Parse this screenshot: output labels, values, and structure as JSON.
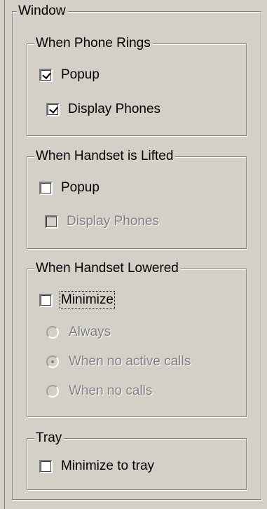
{
  "window_group": {
    "title": "Window",
    "phone_rings": {
      "title": "When Phone Rings",
      "popup": {
        "label": "Popup",
        "checked": true,
        "enabled": true
      },
      "display_phones": {
        "label": "Display Phones",
        "checked": true,
        "enabled": true
      }
    },
    "handset_lifted": {
      "title": "When Handset is Lifted",
      "popup": {
        "label": "Popup",
        "checked": false,
        "enabled": true
      },
      "display_phones": {
        "label": "Display Phones",
        "checked": false,
        "enabled": false
      }
    },
    "handset_lowered": {
      "title": "When Handset Lowered",
      "minimize": {
        "label": "Minimize",
        "checked": false,
        "enabled": true
      },
      "options": [
        {
          "label": "Always",
          "selected": false,
          "enabled": false
        },
        {
          "label": "When no active calls",
          "selected": true,
          "enabled": false
        },
        {
          "label": "When no calls",
          "selected": false,
          "enabled": false
        }
      ]
    },
    "tray": {
      "title": "Tray",
      "minimize_to_tray": {
        "label": "Minimize to tray",
        "checked": false,
        "enabled": true
      }
    }
  },
  "colors": {
    "background": "#d4d0c8",
    "border_dark": "#808080",
    "border_light": "#ffffff",
    "disabled_text": "#808080"
  }
}
